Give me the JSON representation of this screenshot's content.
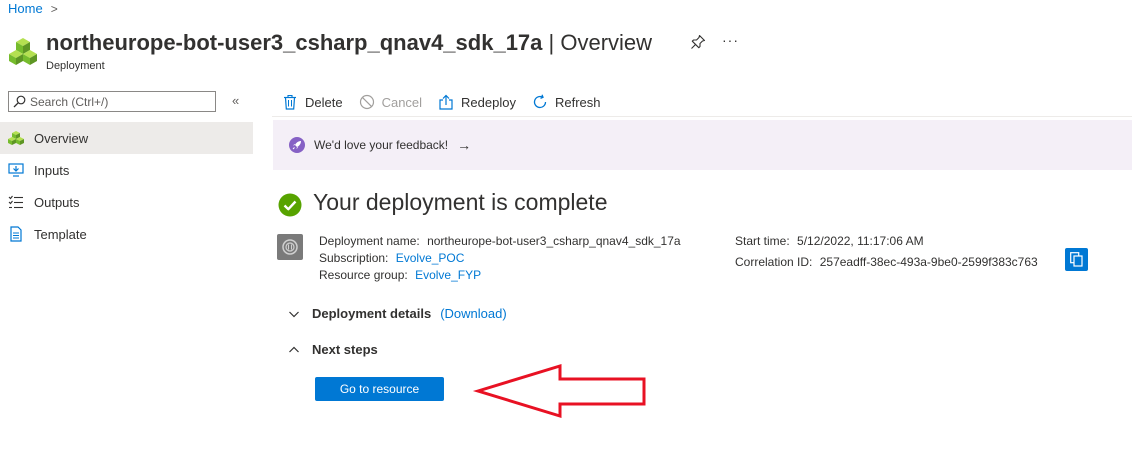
{
  "breadcrumb": {
    "home": "Home",
    "separator": ">"
  },
  "header": {
    "resource_name": "northeurope-bot-user3_csharp_qnav4_sdk_17a",
    "page_suffix": " | Overview",
    "resource_type": "Deployment",
    "more_label": "···"
  },
  "sidebar": {
    "search_placeholder": "Search (Ctrl+/)",
    "collapse_label": "«",
    "items": [
      {
        "label": "Overview",
        "icon": "deployment-cubes-icon",
        "active": true
      },
      {
        "label": "Inputs",
        "icon": "inputs-icon"
      },
      {
        "label": "Outputs",
        "icon": "outputs-icon"
      },
      {
        "label": "Template",
        "icon": "template-icon"
      }
    ]
  },
  "toolbar": {
    "delete_label": "Delete",
    "cancel_label": "Cancel",
    "redeploy_label": "Redeploy",
    "refresh_label": "Refresh"
  },
  "banner": {
    "text": "We'd love your feedback!",
    "arrow": "→"
  },
  "status": {
    "title": "Your deployment is complete"
  },
  "details": {
    "deployment_name_label": "Deployment name:",
    "deployment_name": "northeurope-bot-user3_csharp_qnav4_sdk_17a",
    "subscription_label": "Subscription:",
    "subscription": "Evolve_POC",
    "resource_group_label": "Resource group:",
    "resource_group": "Evolve_FYP",
    "start_time_label": "Start time:",
    "start_time": "5/12/2022, 11:17:06 AM",
    "correlation_id_label": "Correlation ID:",
    "correlation_id": "257eadff-38ec-493a-9be0-2599f383c763"
  },
  "sections": {
    "deployment_details": "Deployment details",
    "download_link": "(Download)",
    "next_steps": "Next steps"
  },
  "actions": {
    "go_to_resource": "Go to resource"
  },
  "colors": {
    "accent": "#0078d4",
    "success": "#57a300",
    "banner_bg": "#f4eff7",
    "banner_icon": "#8661c5",
    "annotation_arrow": "#e81123"
  }
}
